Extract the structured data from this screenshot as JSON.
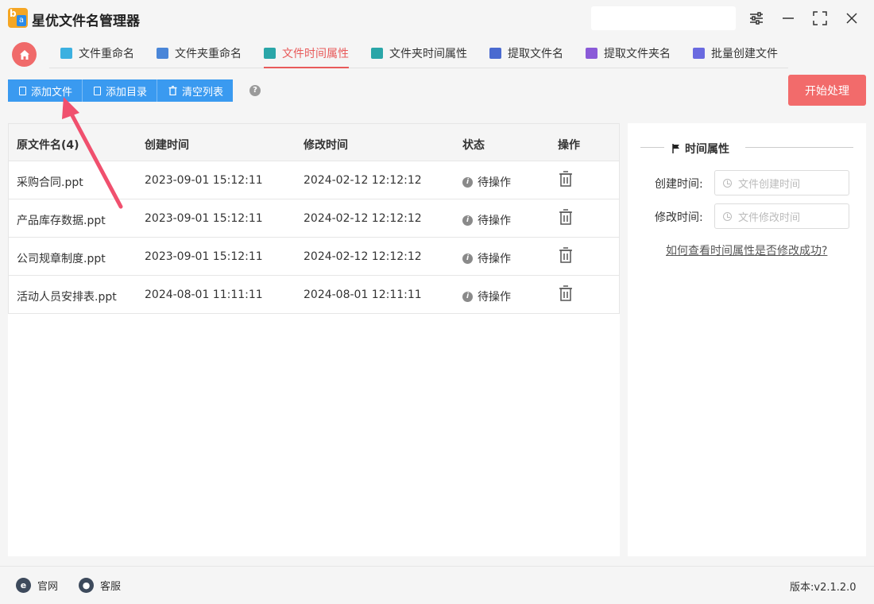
{
  "app": {
    "title": "星优文件名管理器"
  },
  "tabs": [
    {
      "label": "文件重命名",
      "color": "#3bb0e0"
    },
    {
      "label": "文件夹重命名",
      "color": "#4a86d8"
    },
    {
      "label": "文件时间属性",
      "color": "#2aa6a8"
    },
    {
      "label": "文件夹时间属性",
      "color": "#2aa6a8"
    },
    {
      "label": "提取文件名",
      "color": "#4a6ad0"
    },
    {
      "label": "提取文件夹名",
      "color": "#8a5ad8"
    },
    {
      "label": "批量创建文件",
      "color": "#6a6ae0"
    }
  ],
  "active_tab": "文件时间属性",
  "toolbar": {
    "add_file": "添加文件",
    "add_dir": "添加目录",
    "clear_list": "清空列表",
    "help": "?",
    "start": "开始处理"
  },
  "table": {
    "headers": [
      "原文件名(4)",
      "创建时间",
      "修改时间",
      "状态",
      "操作"
    ],
    "rows": [
      {
        "name": "采购合同.ppt",
        "created": "2023-09-01 15:12:11",
        "modified": "2024-02-12 12:12:12",
        "status": "待操作"
      },
      {
        "name": "产品库存数据.ppt",
        "created": "2023-09-01 15:12:11",
        "modified": "2024-02-12 12:12:12",
        "status": "待操作"
      },
      {
        "name": "公司规章制度.ppt",
        "created": "2023-09-01 15:12:11",
        "modified": "2024-02-12 12:12:12",
        "status": "待操作"
      },
      {
        "name": "活动人员安排表.ppt",
        "created": "2024-08-01 11:11:11",
        "modified": "2024-08-01 12:11:11",
        "status": "待操作"
      }
    ]
  },
  "panel": {
    "title": "时间属性",
    "created_label": "创建时间:",
    "created_placeholder": "文件创建时间",
    "modified_label": "修改时间:",
    "modified_placeholder": "文件修改时间",
    "help_link": "如何查看时间属性是否修改成功?"
  },
  "footer": {
    "website": "官网",
    "support": "客服",
    "version": "版本:v2.1.2.0"
  },
  "colors": {
    "accent_red": "#f26b6b",
    "toolbar_blue": "#3a9af0",
    "arrow": "#f0506e"
  }
}
